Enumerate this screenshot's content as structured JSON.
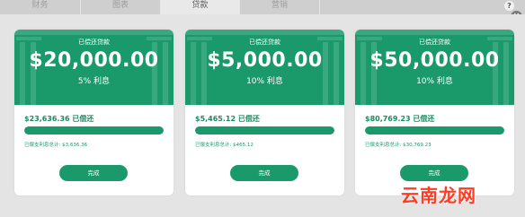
{
  "tabs": [
    {
      "label": "财务",
      "active": false
    },
    {
      "label": "图表",
      "active": false
    },
    {
      "label": "贷款",
      "active": true
    },
    {
      "label": "营销",
      "active": false
    }
  ],
  "help_label": "?",
  "close_label": "×",
  "cards": [
    {
      "header_label": "已偿还贷款",
      "amount": "$20,000.00",
      "rate": "5% 利息",
      "paid_text": "$23,636.36 已偿还",
      "progress": 1.0,
      "interest_text": "已偿支利息总计: $3,636.36",
      "button_label": "完成"
    },
    {
      "header_label": "已偿还贷款",
      "amount": "$5,000.00",
      "rate": "10% 利息",
      "paid_text": "$5,465.12 已偿还",
      "progress": 1.0,
      "interest_text": "已偿支利息总计: $465.12",
      "button_label": "完成"
    },
    {
      "header_label": "已偿还贷款",
      "amount": "$50,000.00",
      "rate": "10% 利息",
      "paid_text": "$80,769.23 已偿还",
      "progress": 1.0,
      "interest_text": "已偿支利息总计: $30,769.23",
      "button_label": "完成"
    }
  ],
  "watermark": "云南龙网",
  "colors": {
    "accent": "#1a9a6a",
    "accent_light": "#cfe8dc",
    "panel": "#e4e4e4",
    "watermark": "#ff3b24"
  }
}
